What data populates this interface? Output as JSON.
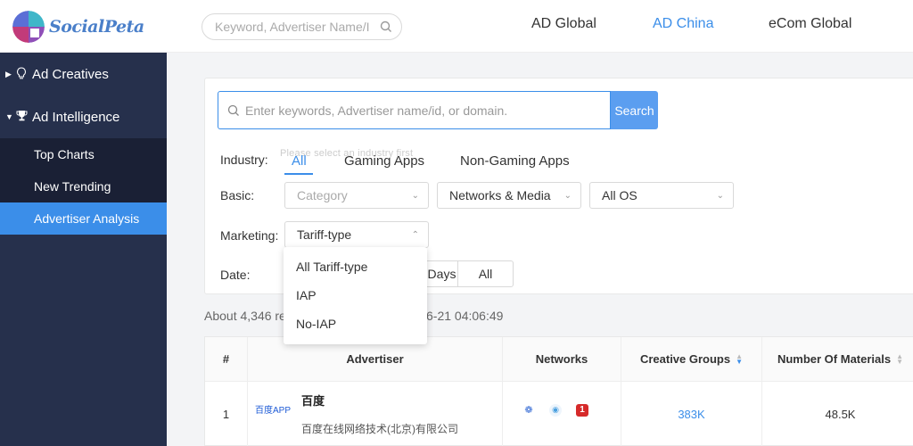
{
  "header": {
    "brand": "SocialPeta",
    "search_placeholder": "Keyword, Advertiser Name/I",
    "nav": [
      {
        "label": "AD Global",
        "active": false
      },
      {
        "label": "AD China",
        "active": true
      },
      {
        "label": "eCom Global",
        "active": false
      }
    ]
  },
  "sidebar": {
    "groups": [
      {
        "label": "Ad Creatives",
        "icon": "lightbulb-icon",
        "expanded": false
      },
      {
        "label": "Ad Intelligence",
        "icon": "trophy-icon",
        "expanded": true
      }
    ],
    "items": [
      {
        "label": "Top Charts",
        "active": false
      },
      {
        "label": "New Trending",
        "active": false
      },
      {
        "label": "Advertiser Analysis",
        "active": true
      }
    ]
  },
  "filters": {
    "search_placeholder": "Enter keywords, Advertiser name/id, or domain.",
    "search_button": "Search",
    "industry_label": "Industry:",
    "industry_tip": "Please select an industry first",
    "industry_options": [
      "All",
      "Gaming Apps",
      "Non-Gaming Apps"
    ],
    "basic_label": "Basic:",
    "basic_category": "Category",
    "basic_networks": "Networks & Media",
    "basic_os": "All OS",
    "marketing_label": "Marketing:",
    "marketing_value": "Tariff-type",
    "date_label": "Date:",
    "date_days": "Days",
    "date_all": "All",
    "tariff_options": [
      "All Tariff-type",
      "IAP",
      "No-IAP"
    ]
  },
  "results": {
    "about_prefix": "About 4,346 re",
    "about_suffix": "6-21 04:06:49"
  },
  "table": {
    "headers": [
      "#",
      "Advertiser",
      "Networks",
      "Creative Groups",
      "Number Of Materials"
    ],
    "rows": [
      {
        "rank": "1",
        "logo_text": "百度APP",
        "name": "百度",
        "company": "百度在线网络技术(北京)有限公司",
        "networks": [
          "paw-icon",
          "signal-icon",
          "number-one-icon"
        ],
        "creative_groups": "383K",
        "materials": "48.5K"
      }
    ]
  },
  "colors": {
    "accent": "#3b8ee9",
    "sidebar_bg": "#26304c",
    "sidebar_sub_bg": "#1a2035"
  }
}
